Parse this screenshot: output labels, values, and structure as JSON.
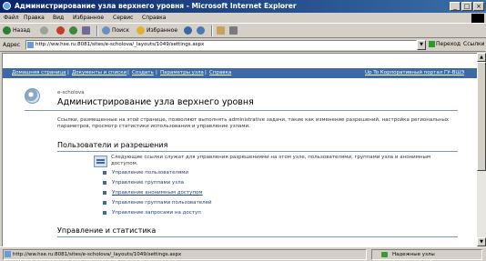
{
  "window": {
    "title": "Администрирование узла верхнего уровня - Microsoft Internet Explorer",
    "min": "_",
    "max": "□",
    "close": "×"
  },
  "menu": [
    "Файл",
    "Правка",
    "Вид",
    "Избранное",
    "Сервис",
    "Справка"
  ],
  "toolbar": {
    "back": "Назад",
    "search": "Поиск",
    "favorites": "Избранное"
  },
  "address": {
    "label": "Адрес",
    "url": "http://ww.hse.ru:8081/sites/e-scholova/_layouts/1049/settings.aspx",
    "dropdown": "▼",
    "go": "Переход",
    "links": "Ссылки"
  },
  "topnav": {
    "items": [
      "Домашняя страница",
      "Документы и списки",
      "Создать",
      "Параметры узла",
      "Справка"
    ],
    "separator": "|",
    "right": "Up To Корпоративный портал ГУ-ВШЭ"
  },
  "page": {
    "site_name": "e-scholova",
    "title": "Администрирование узла верхнего уровня",
    "intro": "Ссылки, размещенные на этой странице, позволяют выполнять administrative задачи, такие как изменение разрешений, настройка региональных параметров, просмотр статистики использования и управление узлами.",
    "section1": {
      "heading": "Пользователи и разрешения",
      "description": "Следующие ссылки служат для управления разрешениями на этом узле, пользователями, группами узла и анонимным доступом.",
      "links": [
        "Управление пользователями",
        "Управление группами узла",
        "Управление анонимным доступом",
        "Управление группами пользователей",
        "Управление запросами на доступ"
      ]
    },
    "section2": {
      "heading": "Управление и статистика"
    }
  },
  "status": {
    "url": "http://ww.hse.ru:8081/sites/e-scholova/_layouts/1049/settings.aspx",
    "zone": "Надежные узлы"
  },
  "scrollbar": {
    "up": "▲",
    "down": "▼"
  }
}
